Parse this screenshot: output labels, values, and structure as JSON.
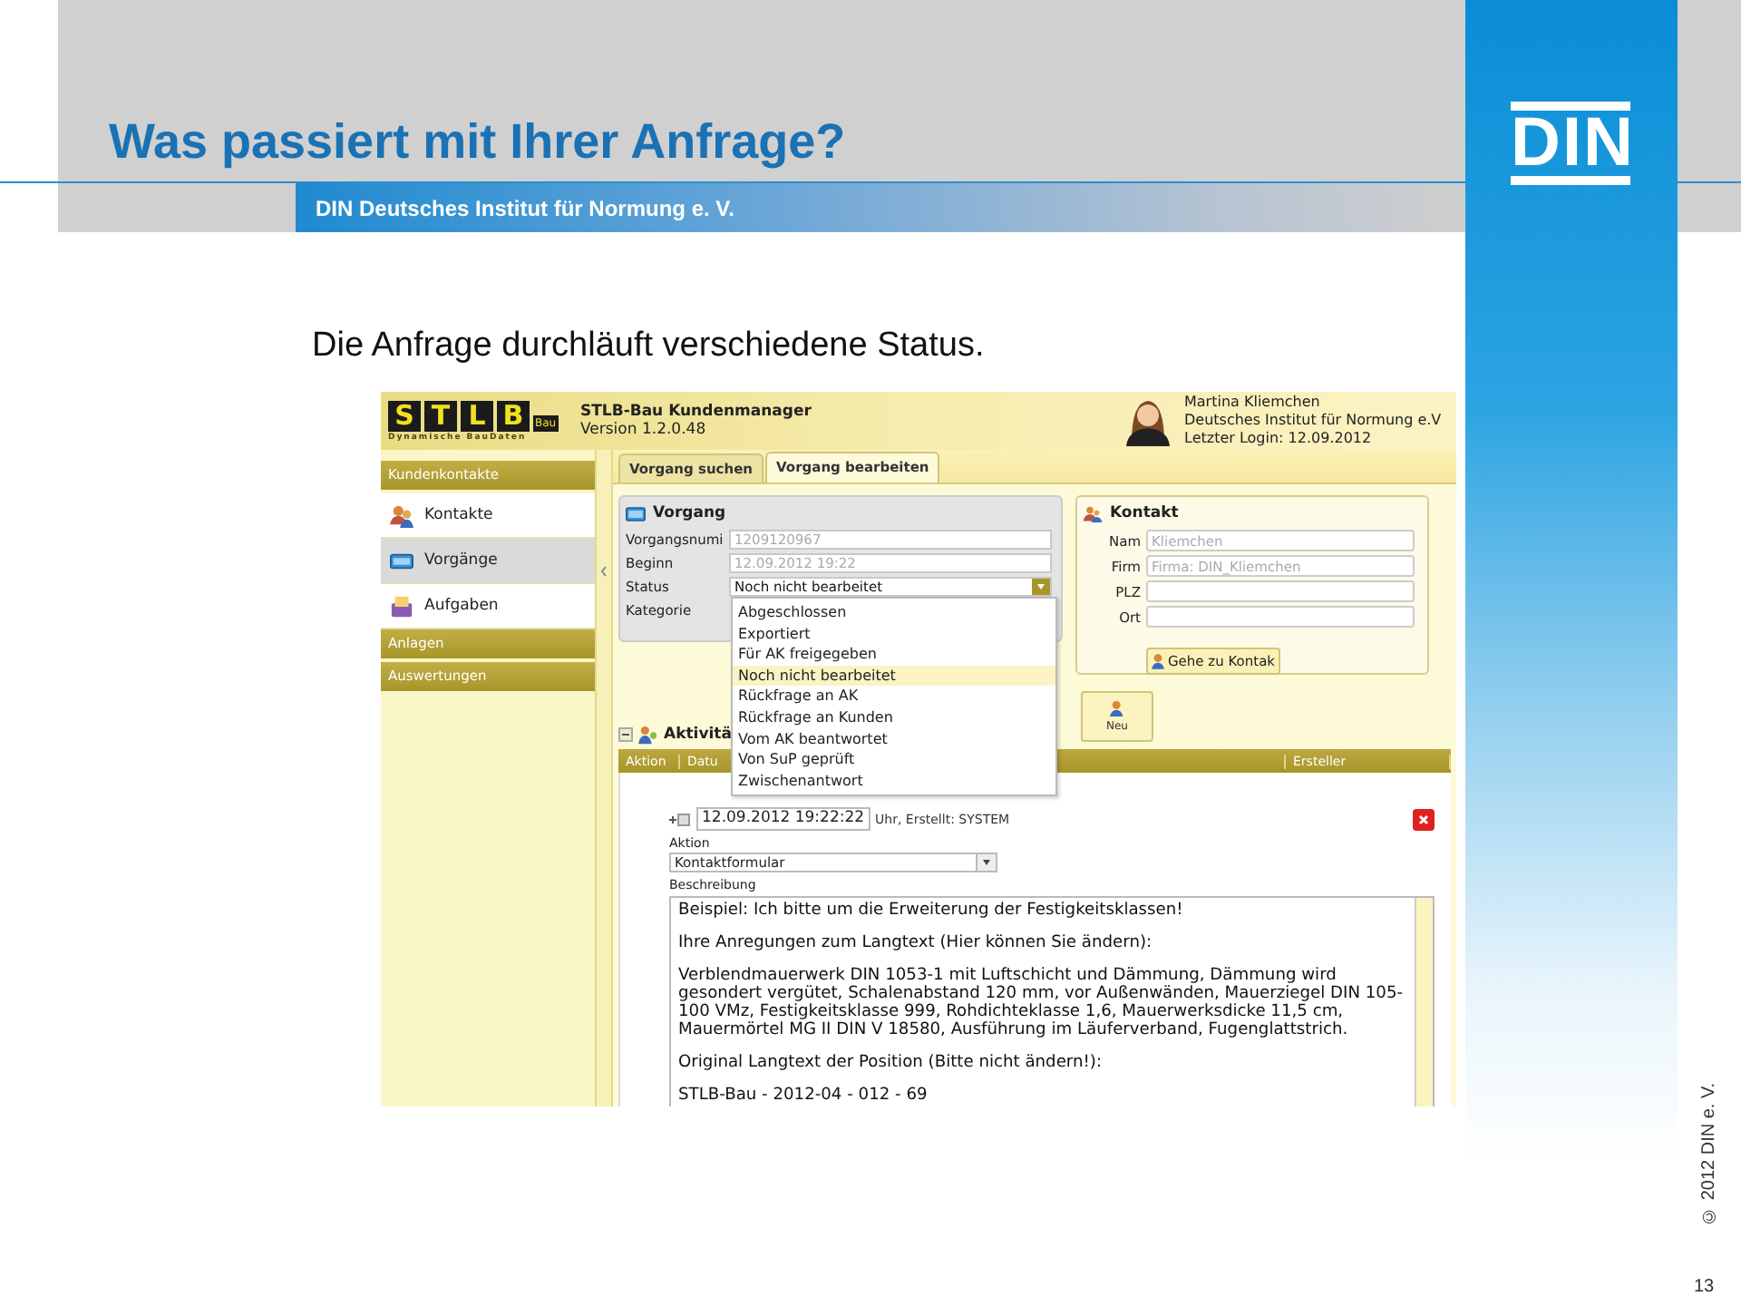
{
  "slide": {
    "title": "Was passiert mit Ihrer Anfrage?",
    "org_bar": "DIN Deutsches Institut für Normung e. V.",
    "logo": "DIN",
    "subtitle": "Die Anfrage durchläuft verschiedene Status.",
    "copyright": "© 2012 DIN e. V.",
    "page_number": "13"
  },
  "app": {
    "header": {
      "logo_letters": [
        "S",
        "T",
        "L",
        "B"
      ],
      "logo_suffix": "Bau",
      "logo_tagline": "Dynamische BauDaten",
      "title": "STLB-Bau Kundenmanager",
      "version": "Version 1.2.0.48",
      "user_lines": [
        "Martina Kliemchen",
        "Deutsches Institut für Normung e.V",
        "Letzter Login: 12.09.2012"
      ]
    },
    "sidebar": [
      {
        "title": "Kundenkontakte",
        "items": [
          {
            "label": "Kontakte",
            "kind": "contacts",
            "selected": false
          },
          {
            "label": "Vorgänge",
            "kind": "cases",
            "selected": true
          },
          {
            "label": "Aufgaben",
            "kind": "tasks",
            "selected": false
          }
        ]
      },
      {
        "title": "Anlagen"
      },
      {
        "title": "Auswertungen"
      }
    ],
    "tabs": [
      {
        "label": "Vorgang suchen",
        "selected": false
      },
      {
        "label": "Vorgang bearbeiten",
        "selected": true
      }
    ],
    "vorgang": {
      "title": "Vorgang",
      "fields": [
        {
          "label": "Vorgangsnumi",
          "kind": "text",
          "value": "1209120967",
          "disabled": true
        },
        {
          "label": "Beginn",
          "kind": "text",
          "value": "12.09.2012 19:22",
          "disabled": true
        },
        {
          "label": "Status",
          "kind": "select",
          "value": "Noch nicht bearbeitet"
        },
        {
          "label": "Kategorie",
          "kind": "hidden"
        }
      ]
    },
    "status_dropdown": [
      {
        "label": "Abgeschlossen",
        "selected": false
      },
      {
        "label": "Exportiert",
        "selected": false
      },
      {
        "label": "Für AK freigegeben",
        "selected": false
      },
      {
        "label": "Noch nicht bearbeitet",
        "selected": true
      },
      {
        "label": "Rückfrage an AK",
        "selected": false
      },
      {
        "label": "Rückfrage an Kunden",
        "selected": false
      },
      {
        "label": "Vom AK beantwortet",
        "selected": false
      },
      {
        "label": "Von SuP geprüft",
        "selected": false
      },
      {
        "label": "Zwischenantwort",
        "selected": false
      }
    ],
    "kontakt": {
      "title": "Kontakt",
      "fields": [
        {
          "label": "Nam",
          "placeholder": "Kliemchen"
        },
        {
          "label": "Firm",
          "placeholder": "Firma: DIN_Kliemchen"
        },
        {
          "label": "PLZ"
        },
        {
          "label": "Ort"
        }
      ],
      "button": "Gehe zu Kontak"
    },
    "new_button": "Neu",
    "activities": {
      "title": "Aktivitä",
      "columns": [
        "Aktion",
        "Datu",
        "Ersteller"
      ],
      "date": "12.09.2012 19:22:22",
      "meta": "Uhr, Erstellt: SYSTEM",
      "action_label": "Aktion",
      "action": "Kontaktformular",
      "description_label": "Beschreibung",
      "description": [
        "Beispiel: Ich bitte um die Erweiterung der Festigkeitsklassen!",
        "Ihre Anregungen zum Langtext (Hier können Sie ändern):",
        "Verblendmauerwerk DIN 1053-1 mit Luftschicht und Dämmung, Dämmung wird gesondert vergütet, Schalenabstand 120 mm, vor Außenwänden, Mauerziegel DIN 105-100 VMz, Festigkeitsklasse 999, Rohdichteklasse 1,6, Mauerwerksdicke 11,5 cm, Mauermörtel MG II DIN V 18580, Ausführung im Läuferverband, Fugenglattstrich.",
        "Original Langtext der Position (Bitte nicht ändern!):",
        "STLB-Bau - 2012-04 - 012 - 69"
      ]
    }
  }
}
